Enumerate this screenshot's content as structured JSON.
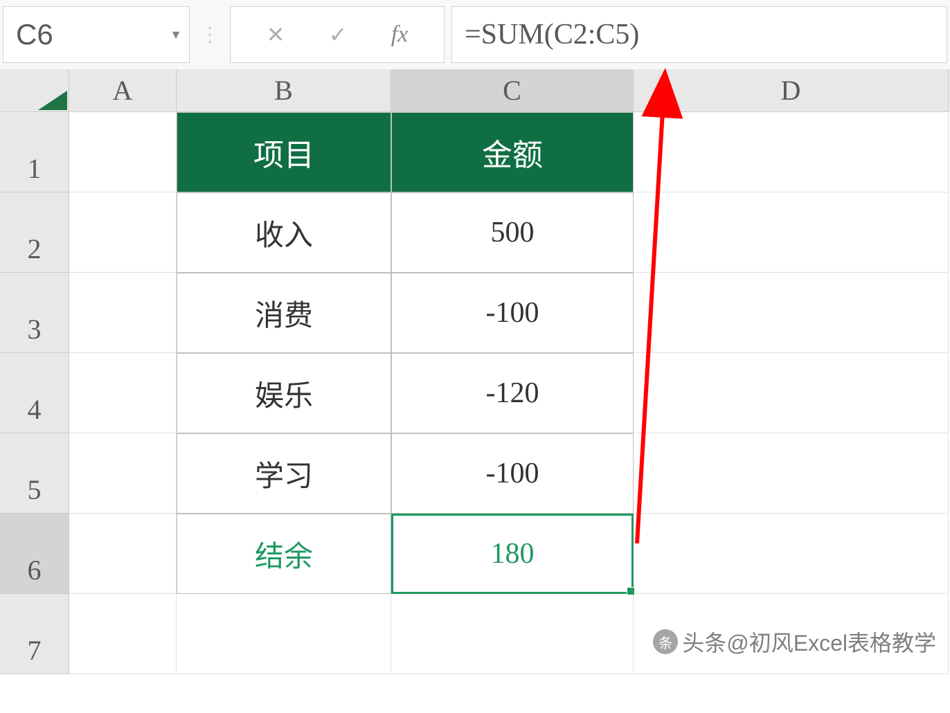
{
  "formulaBar": {
    "cellReference": "C6",
    "formula": "=SUM(C2:C5)"
  },
  "columns": [
    "A",
    "B",
    "C",
    "D"
  ],
  "rows": [
    "1",
    "2",
    "3",
    "4",
    "5",
    "6",
    "7"
  ],
  "tableHeader": {
    "b1": "项目",
    "c1": "金额"
  },
  "tableData": [
    {
      "label": "收入",
      "value": "500"
    },
    {
      "label": "消费",
      "value": "-100"
    },
    {
      "label": "娱乐",
      "value": "-120"
    },
    {
      "label": "学习",
      "value": "-100"
    }
  ],
  "tableResult": {
    "label": "结余",
    "value": "180"
  },
  "selectedCell": "C6",
  "watermark": "头条@初风Excel表格教学",
  "colors": {
    "headerGreen": "#0f6e42",
    "resultGreen": "#1f9960",
    "arrowRed": "#ff0000"
  }
}
